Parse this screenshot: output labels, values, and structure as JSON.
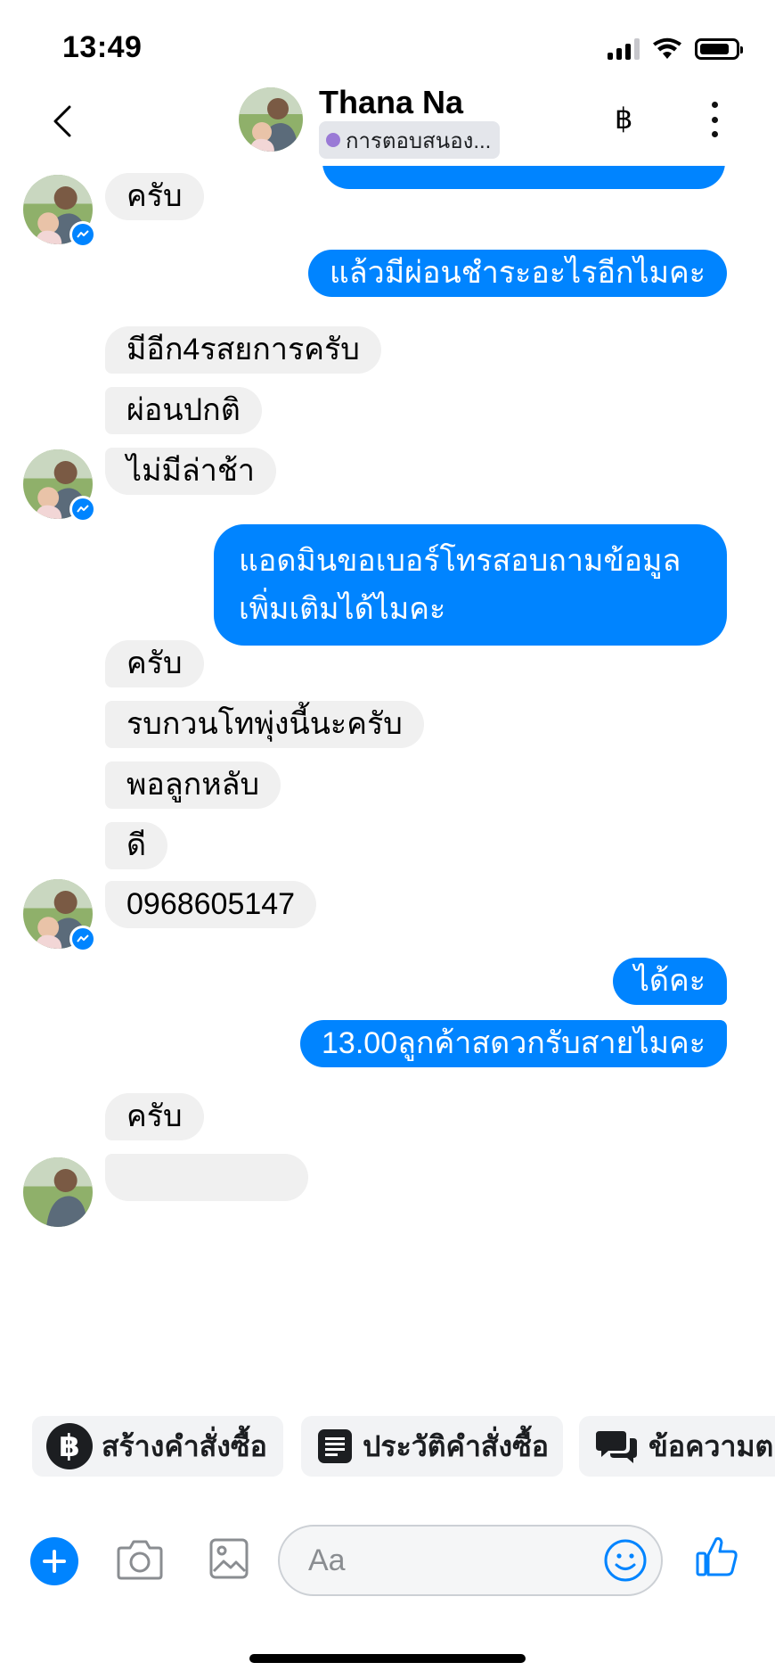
{
  "status_bar": {
    "time": "13:49"
  },
  "header": {
    "contact_name": "Thana Na",
    "status_label": "การตอบสนอง...",
    "baht_symbol": "฿"
  },
  "messages": [
    {
      "side": "in",
      "text": "ครับ",
      "avatar": true
    },
    {
      "side": "out",
      "text": "แล้วมีผ่อนชำระอะไรอีกไมคะ"
    },
    {
      "side": "in",
      "text": "มีอีก4รสยการครับ"
    },
    {
      "side": "in",
      "text": "ผ่อนปกติ"
    },
    {
      "side": "in",
      "text": "ไม่มีล่าช้า",
      "avatar": true
    },
    {
      "side": "out",
      "text": "แอดมินขอเบอร์โทรสอบถามข้อมูลเพิ่มเติมได้ไมคะ"
    },
    {
      "side": "in",
      "text": "ครับ"
    },
    {
      "side": "in",
      "text": "รบกวนโทพุ่งนี้นะครับ"
    },
    {
      "side": "in",
      "text": "พอลูกหลับ"
    },
    {
      "side": "in",
      "text": "ดี"
    },
    {
      "side": "in",
      "text": "0968605147",
      "avatar": true
    },
    {
      "side": "out",
      "text": "ได้คะ"
    },
    {
      "side": "out",
      "text": "13.00ลูกค้าสดวกรับสายไมคะ"
    },
    {
      "side": "in",
      "text": "ครับ"
    }
  ],
  "quick_actions": [
    {
      "label": "สร้างคำสั่งซื้อ",
      "icon": "baht-circle-icon",
      "icon_glyph": "฿"
    },
    {
      "label": "ประวัติคำสั่งซื้อ",
      "icon": "order-history-icon"
    },
    {
      "label": "ข้อความตอ",
      "icon": "saved-replies-icon"
    }
  ],
  "composer": {
    "placeholder": "Aa"
  },
  "colors": {
    "accent": "#0084ff",
    "incoming_bubble": "#f0f0f0",
    "status_dot": "#9a7ad6"
  }
}
